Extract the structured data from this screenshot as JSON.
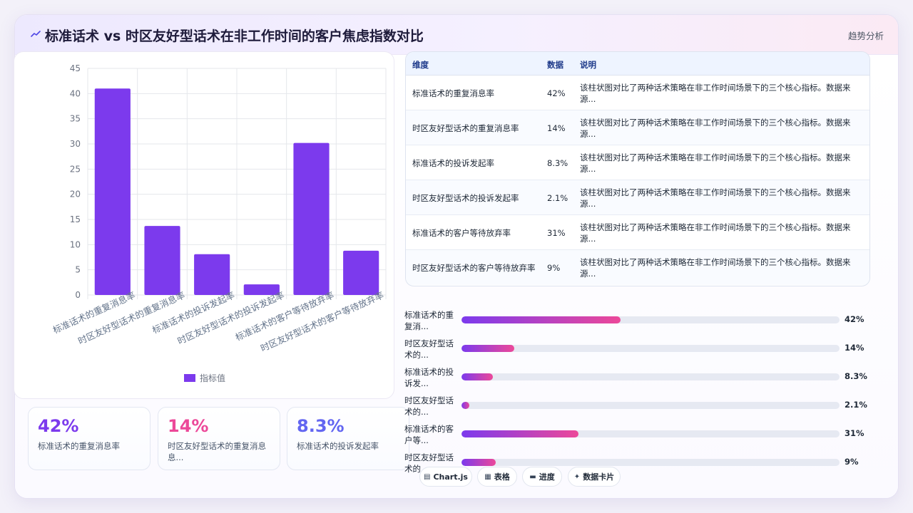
{
  "header": {
    "icon": "chart-line-icon",
    "title": "标准话术 vs 时区友好型话术在非工作时间的客户焦虑指数对比",
    "link": "趋势分析"
  },
  "chart_data": {
    "type": "bar",
    "categories": [
      "标准话术的重复消息率",
      "时区友好型话术的重复消息率",
      "标准话术的投诉发起率",
      "时区友好型话术的投诉发起率",
      "标准话术的客户等待放弃率",
      "时区友好型话术的客户等待放弃率"
    ],
    "series": [
      {
        "name": "指标值",
        "values": [
          41,
          13.7,
          8.1,
          2.1,
          30.2,
          8.8
        ],
        "color": "#7c3aed"
      }
    ],
    "ylim": [
      0,
      45
    ],
    "yticks": [
      0,
      5,
      10,
      15,
      20,
      25,
      30,
      35,
      40,
      45
    ],
    "grid": true,
    "legend": "bottom"
  },
  "kpis": [
    {
      "value": "42%",
      "label": "标准话术的重复消息率",
      "color": "#7c3aed"
    },
    {
      "value": "14%",
      "label": "时区友好型话术的重复消息息...",
      "color": "#ec4899"
    },
    {
      "value": "8.3%",
      "label": "标准话术的投诉发起率",
      "color": "#6366f1"
    }
  ],
  "table": {
    "headers": [
      "维度",
      "数据",
      "说明"
    ],
    "rows": [
      {
        "name": "标准话术的重复消息率",
        "value": "42%",
        "desc": "该柱状图对比了两种话术策略在非工作时间场景下的三个核心指标。数据来源..."
      },
      {
        "name": "时区友好型话术的重复消息率",
        "value": "14%",
        "desc": "该柱状图对比了两种话术策略在非工作时间场景下的三个核心指标。数据来源..."
      },
      {
        "name": "标准话术的投诉发起率",
        "value": "8.3%",
        "desc": "该柱状图对比了两种话术策略在非工作时间场景下的三个核心指标。数据来源..."
      },
      {
        "name": "时区友好型话术的投诉发起率",
        "value": "2.1%",
        "desc": "该柱状图对比了两种话术策略在非工作时间场景下的三个核心指标。数据来源..."
      },
      {
        "name": "标准话术的客户等待放弃率",
        "value": "31%",
        "desc": "该柱状图对比了两种话术策略在非工作时间场景下的三个核心指标。数据来源..."
      },
      {
        "name": "时区友好型话术的客户等待放弃率",
        "value": "9%",
        "desc": "该柱状图对比了两种话术策略在非工作时间场景下的三个核心指标。数据来源..."
      }
    ]
  },
  "progress": [
    {
      "label": "标准话术的重复消...",
      "value": "42%",
      "fraction": 0.42
    },
    {
      "label": "时区友好型话术的...",
      "value": "14%",
      "fraction": 0.14
    },
    {
      "label": "标准话术的投诉发...",
      "value": "8.3%",
      "fraction": 0.083
    },
    {
      "label": "时区友好型话术的...",
      "value": "2.1%",
      "fraction": 0.021
    },
    {
      "label": "标准话术的客户等...",
      "value": "31%",
      "fraction": 0.31
    },
    {
      "label": "时区友好型话术的...",
      "value": "9%",
      "fraction": 0.09
    }
  ],
  "chips": [
    {
      "icon": "chart-icon",
      "glyph": "▤",
      "label": "Chart.js"
    },
    {
      "icon": "table-icon",
      "glyph": "▦",
      "label": "表格"
    },
    {
      "icon": "progress-icon",
      "glyph": "▬",
      "label": "进度"
    },
    {
      "icon": "sparkle-icon",
      "glyph": "✦",
      "label": "数据卡片"
    }
  ]
}
